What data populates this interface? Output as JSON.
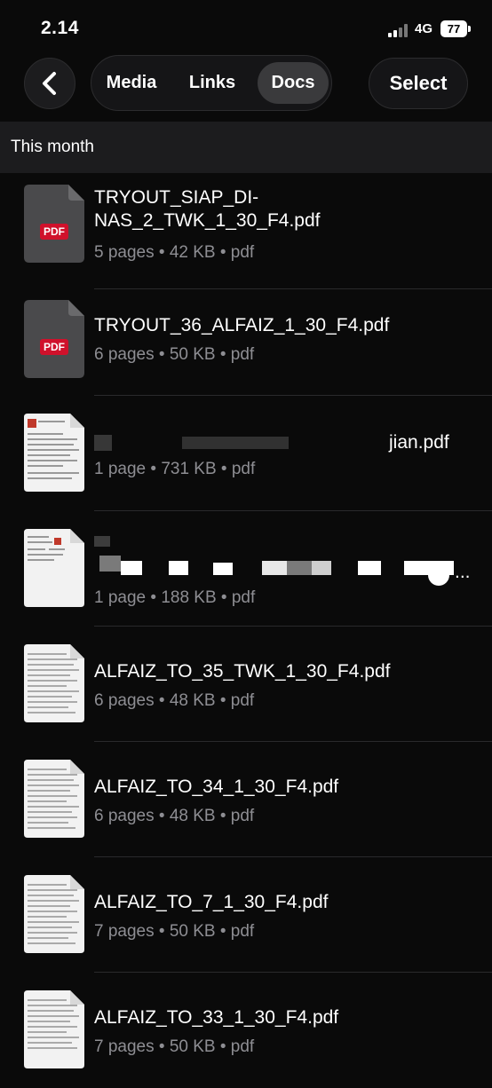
{
  "status_bar": {
    "time": "2.14",
    "network": "4G",
    "battery": "77"
  },
  "nav": {
    "tabs": [
      {
        "label": "Media",
        "active": false
      },
      {
        "label": "Links",
        "active": false
      },
      {
        "label": "Docs",
        "active": true
      }
    ],
    "select_label": "Select"
  },
  "section_title": "This month",
  "files": [
    {
      "name": "TRYOUT_SIAP_DI-NAS_2_TWK_1_30_F4.pdf",
      "name_line1": "TRYOUT_SIAP_DI-",
      "name_line2": "NAS_2_TWK_1_30_F4.pdf",
      "meta": "5 pages • 42 KB • pdf",
      "thumb": "pdf-icon"
    },
    {
      "name": "TRYOUT_36_ALFAIZ_1_30_F4.pdf",
      "meta": "6 pages • 50 KB • pdf",
      "thumb": "pdf-icon"
    },
    {
      "name": "jian.pdf",
      "meta": "1 page • 731 KB • pdf",
      "thumb": "document-preview",
      "redacted": true
    },
    {
      "name": "...",
      "meta": "1 page • 188 KB • pdf",
      "thumb": "document-preview",
      "redacted": true
    },
    {
      "name": "ALFAIZ_TO_35_TWK_1_30_F4.pdf",
      "meta": "6 pages • 48 KB • pdf",
      "thumb": "document-preview"
    },
    {
      "name": "ALFAIZ_TO_34_1_30_F4.pdf",
      "meta": "6 pages • 48 KB • pdf",
      "thumb": "document-preview"
    },
    {
      "name": "ALFAIZ_TO_7_1_30_F4.pdf",
      "meta": "7 pages • 50 KB • pdf",
      "thumb": "document-preview"
    },
    {
      "name": "ALFAIZ_TO_33_1_30_F4.pdf",
      "meta": "7 pages • 50 KB • pdf",
      "thumb": "document-preview"
    }
  ],
  "pdf_badge_label": "PDF"
}
